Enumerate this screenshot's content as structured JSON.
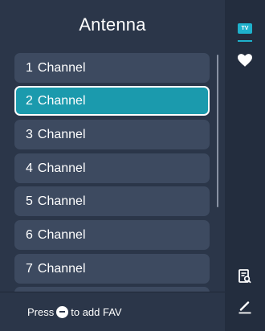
{
  "header": {
    "title": "Antenna"
  },
  "channels": [
    {
      "number": "1",
      "name": "Channel",
      "selected": false
    },
    {
      "number": "2",
      "name": "Channel",
      "selected": true
    },
    {
      "number": "3",
      "name": "Channel",
      "selected": false
    },
    {
      "number": "4",
      "name": "Channel",
      "selected": false
    },
    {
      "number": "5",
      "name": "Channel",
      "selected": false
    },
    {
      "number": "6",
      "name": "Channel",
      "selected": false
    },
    {
      "number": "7",
      "name": "Channel",
      "selected": false
    },
    {
      "number": "",
      "name": "",
      "selected": false
    }
  ],
  "footer": {
    "press_label": "Press",
    "hint_label": "to add FAV"
  },
  "rail": {
    "tv_badge": "TV",
    "icons": [
      "tv-icon",
      "heart-icon",
      "search-list-icon",
      "edit-icon"
    ],
    "accent_color": "#1eb1cc"
  },
  "colors": {
    "panel_bg": "#2b3649",
    "item_bg": "#3d4a60",
    "selected_bg": "#1b9aad",
    "rail_bg": "#232d3e"
  }
}
